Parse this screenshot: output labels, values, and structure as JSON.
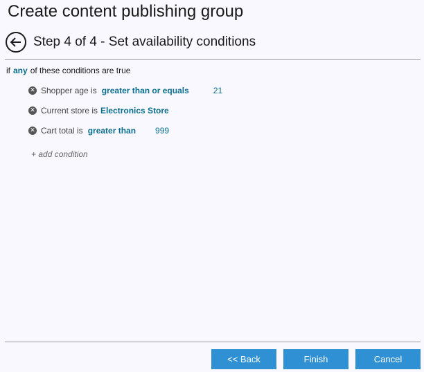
{
  "header": {
    "title": "Create content publishing group",
    "step_title": "Step 4 of 4 - Set availability conditions"
  },
  "rule": {
    "prefix": "if",
    "quantifier": "any",
    "suffix": "of these conditions are true"
  },
  "conditions": [
    {
      "label": "Shopper age is",
      "operator": "greater than or equals",
      "value": "21"
    },
    {
      "label": "Current store is",
      "operator": "Electronics Store",
      "value": ""
    },
    {
      "label": "Cart total is",
      "operator": "greater than",
      "value": "999"
    }
  ],
  "add_condition_label": "+ add condition",
  "buttons": {
    "back": "<< Back",
    "finish": "Finish",
    "cancel": "Cancel"
  },
  "icons": {
    "back": "arrow-left-circle-icon",
    "remove": "remove-condition-icon"
  },
  "colors": {
    "accent_link": "#0b6e8f",
    "button": "#2f91d3",
    "background": "#f8f8fe"
  }
}
